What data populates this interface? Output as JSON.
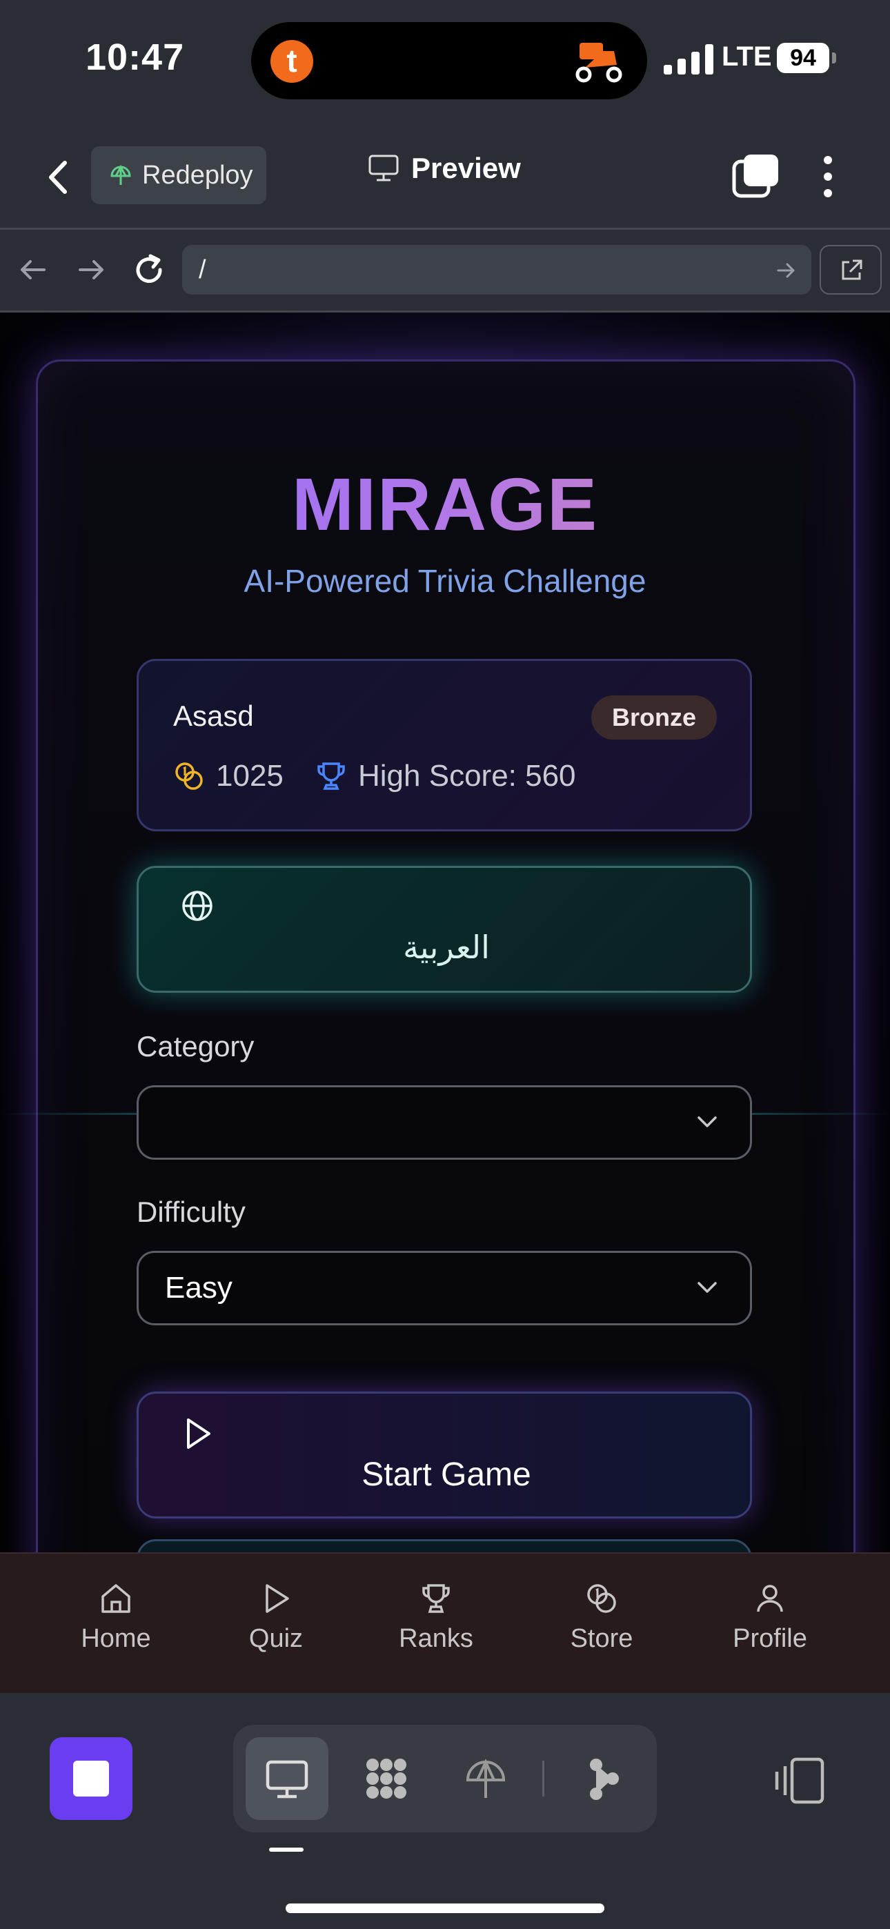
{
  "status_bar": {
    "time": "10:47",
    "network": "LTE",
    "battery": "94",
    "island_app_letter": "t"
  },
  "toolbar": {
    "redeploy_label": "Redeploy",
    "preview_label": "Preview"
  },
  "url_bar": {
    "url": "/"
  },
  "app": {
    "title": "MIRAGE",
    "subtitle": "AI-Powered Trivia Challenge",
    "player": {
      "username": "Asasd",
      "tier": "Bronze",
      "coins": "1025",
      "high_score": "High Score: 560"
    },
    "language_button": "العربية",
    "category": {
      "label": "Category",
      "value": ""
    },
    "difficulty": {
      "label": "Difficulty",
      "value": "Easy"
    },
    "start_button": "Start Game"
  },
  "bottom_nav": {
    "items": [
      {
        "label": "Home",
        "icon": "home-icon"
      },
      {
        "label": "Quiz",
        "icon": "play-icon"
      },
      {
        "label": "Ranks",
        "icon": "trophy-icon"
      },
      {
        "label": "Store",
        "icon": "coins-icon"
      },
      {
        "label": "Profile",
        "icon": "user-icon"
      }
    ]
  },
  "dock": {
    "tabs": [
      "monitor-icon",
      "grid-icon",
      "deploy-icon",
      "share-icon"
    ],
    "accent": "#6a3ef0"
  },
  "colors": {
    "background": "#2a2d33",
    "title_gradient": [
      "#8b6bff",
      "#d58aa8"
    ],
    "subtitle": "#7fa3e6",
    "nav_bg": "#271b1e"
  }
}
